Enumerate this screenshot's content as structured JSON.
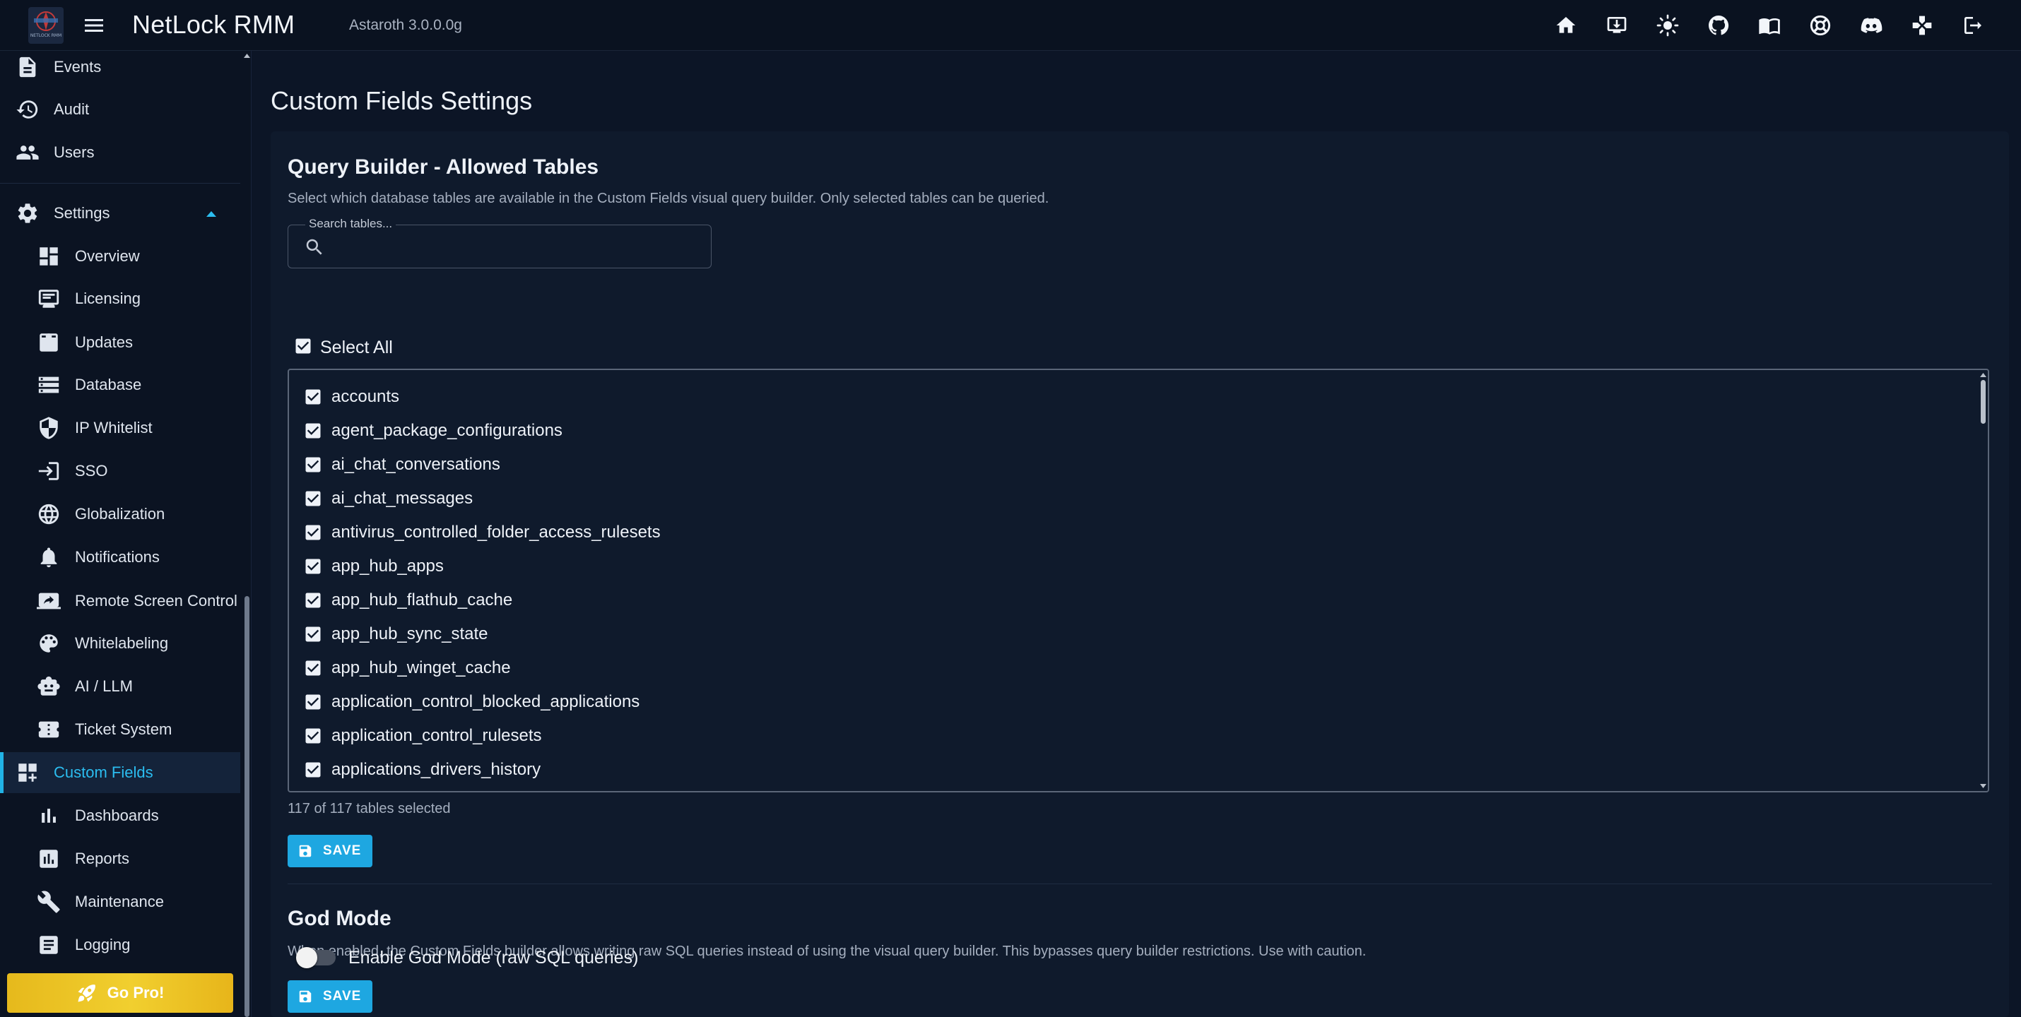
{
  "app": {
    "title": "NetLock RMM",
    "version": "Astaroth 3.0.0.0g",
    "logo_text": "NETLOCK RMM"
  },
  "topbar_icons": [
    "home-icon",
    "install-download-icon",
    "theme-sun-icon",
    "github-icon",
    "docs-book-icon",
    "support-lifebuoy-icon",
    "discord-icon",
    "gamepad-icon",
    "logout-icon"
  ],
  "sidebar": {
    "top_items": [
      {
        "label": "Events",
        "icon": "events-doc-icon"
      },
      {
        "label": "Audit",
        "icon": "history-icon"
      },
      {
        "label": "Users",
        "icon": "users-icon"
      }
    ],
    "settings_group": {
      "label": "Settings",
      "icon": "gear-icon",
      "expanded": true
    },
    "sub_items": [
      {
        "label": "Overview",
        "icon": "dashboard-icon"
      },
      {
        "label": "Licensing",
        "icon": "license-icon"
      },
      {
        "label": "Updates",
        "icon": "updates-icon"
      },
      {
        "label": "Database",
        "icon": "database-icon"
      },
      {
        "label": "IP Whitelist",
        "icon": "shield-icon"
      },
      {
        "label": "SSO",
        "icon": "login-icon"
      },
      {
        "label": "Globalization",
        "icon": "globe-icon"
      },
      {
        "label": "Notifications",
        "icon": "bell-icon"
      },
      {
        "label": "Remote Screen Control",
        "icon": "screen-share-icon"
      },
      {
        "label": "Whitelabeling",
        "icon": "palette-icon"
      },
      {
        "label": "AI / LLM",
        "icon": "robot-icon"
      },
      {
        "label": "Ticket System",
        "icon": "ticket-icon"
      }
    ],
    "active_item": {
      "label": "Custom Fields",
      "icon": "custom-fields-icon"
    },
    "after_items": [
      {
        "label": "Dashboards",
        "icon": "bar-chart-icon"
      },
      {
        "label": "Reports",
        "icon": "report-icon"
      },
      {
        "label": "Maintenance",
        "icon": "wrench-icon"
      },
      {
        "label": "Logging",
        "icon": "log-icon"
      }
    ],
    "go_pro_label": "Go Pro!"
  },
  "page": {
    "title": "Custom Fields Settings"
  },
  "query_builder": {
    "title": "Query Builder - Allowed Tables",
    "description": "Select which database tables are available in the Custom Fields visual query builder. Only selected tables can be queried.",
    "search_legend": "Search tables...",
    "search_value": "",
    "select_all_label": "Select All",
    "select_all_checked": true,
    "tables": [
      "accounts",
      "agent_package_configurations",
      "ai_chat_conversations",
      "ai_chat_messages",
      "antivirus_controlled_folder_access_rulesets",
      "app_hub_apps",
      "app_hub_flathub_cache",
      "app_hub_sync_state",
      "app_hub_winget_cache",
      "application_control_blocked_applications",
      "application_control_rulesets",
      "applications_drivers_history"
    ],
    "count_text": "117 of 117 tables selected",
    "save_label": "SAVE"
  },
  "god_mode": {
    "title": "God Mode",
    "description": "When enabled, the Custom Fields builder allows writing raw SQL queries instead of using the visual query builder. This bypasses query builder restrictions. Use with caution.",
    "toggle_label": "Enable God Mode (raw SQL queries)",
    "enabled": false,
    "save_label": "SAVE"
  },
  "colors": {
    "accent": "#1ea7e1",
    "active_text": "#2bbdf0",
    "background": "#0c1526",
    "card": "#0f1a2c",
    "gold": "#f1cf2f"
  }
}
